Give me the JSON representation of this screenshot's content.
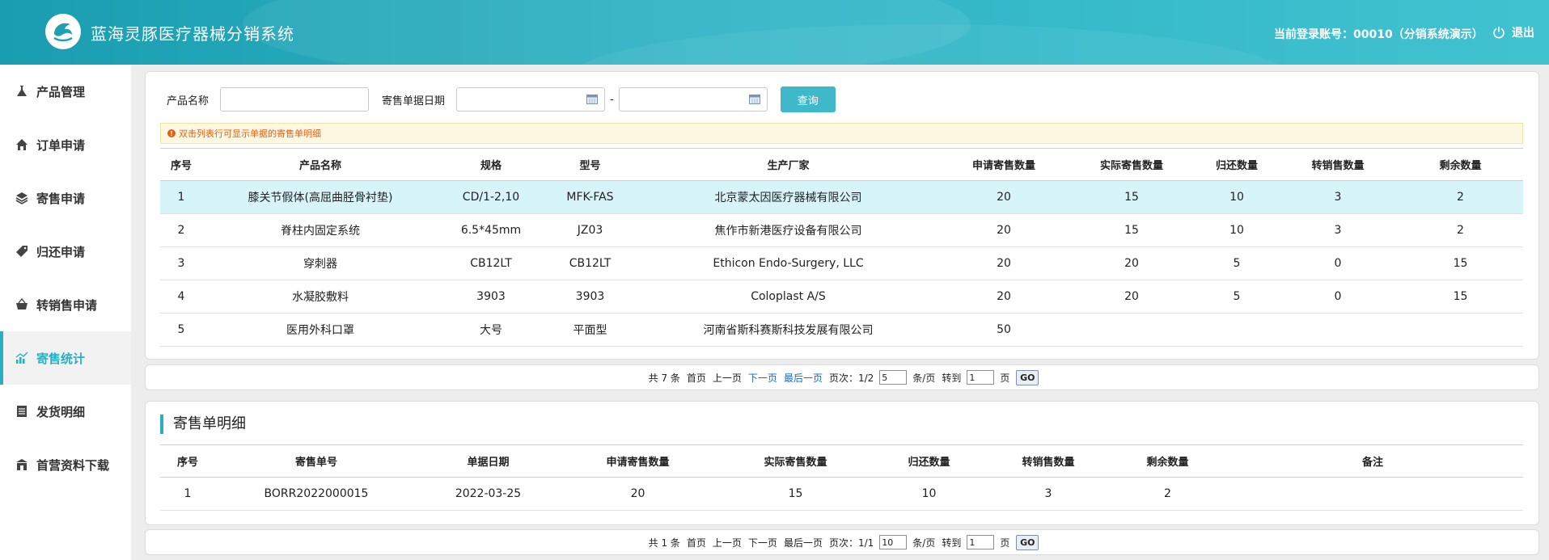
{
  "header": {
    "app_title": "蓝海灵豚医疗器械分销系统",
    "account_text": "当前登录账号：00010（分销系统演示）",
    "logout_label": "退出"
  },
  "sidebar": {
    "items": [
      {
        "label": "产品管理",
        "icon": "flask-icon"
      },
      {
        "label": "订单申请",
        "icon": "home-icon"
      },
      {
        "label": "寄售申请",
        "icon": "layers-icon"
      },
      {
        "label": "归还申请",
        "icon": "tag-icon"
      },
      {
        "label": "转销售申请",
        "icon": "basket-icon"
      },
      {
        "label": "寄售统计",
        "icon": "chart-icon",
        "active": true
      },
      {
        "label": "发货明细",
        "icon": "list-icon"
      },
      {
        "label": "首营资料下载",
        "icon": "building-icon"
      }
    ]
  },
  "search": {
    "product_name_label": "产品名称",
    "product_name_value": "",
    "date_label": "寄售单据日期",
    "date_from": "",
    "date_to": "",
    "date_separator": "-",
    "query_button": "查询"
  },
  "tip": "双击列表行可显示单据的寄售单明细",
  "main_table": {
    "headers": [
      "序号",
      "产品名称",
      "规格",
      "型号",
      "生产厂家",
      "申请寄售数量",
      "实际寄售数量",
      "归还数量",
      "转销售数量",
      "剩余数量"
    ],
    "rows": [
      [
        "1",
        "膝关节假体(高屈曲胫骨衬垫)",
        "CD/1-2,10",
        "MFK-FAS",
        "北京蒙太因医疗器械有限公司",
        "20",
        "15",
        "10",
        "3",
        "2"
      ],
      [
        "2",
        "脊柱内固定系统",
        "6.5*45mm",
        "JZ03",
        "焦作市新港医疗设备有限公司",
        "20",
        "15",
        "10",
        "3",
        "2"
      ],
      [
        "3",
        "穿刺器",
        "CB12LT",
        "CB12LT",
        "Ethicon Endo-Surgery, LLC",
        "20",
        "20",
        "5",
        "0",
        "15"
      ],
      [
        "4",
        "水凝胶敷料",
        "3903",
        "3903",
        "Coloplast A/S",
        "20",
        "20",
        "5",
        "0",
        "15"
      ],
      [
        "5",
        "医用外科口罩",
        "大号",
        "平面型",
        "河南省斯科赛斯科技发展有限公司",
        "50",
        "",
        "",
        "",
        ""
      ]
    ]
  },
  "main_pager": {
    "total": "共 7 条",
    "first": "首页",
    "prev": "上一页",
    "next": "下一页",
    "last": "最后一页",
    "page_label": "页次：1/2",
    "page_size": "5",
    "per_page": "条/页",
    "goto_label": "转到",
    "goto_value": "1",
    "page_unit": "页",
    "go": "GO"
  },
  "detail": {
    "title": "寄售单明细",
    "headers": [
      "序号",
      "寄售单号",
      "单据日期",
      "申请寄售数量",
      "实际寄售数量",
      "归还数量",
      "转销售数量",
      "剩余数量",
      "备注"
    ],
    "rows": [
      [
        "1",
        "BORR2022000015",
        "2022-03-25",
        "20",
        "15",
        "10",
        "3",
        "2",
        ""
      ]
    ]
  },
  "detail_pager": {
    "total": "共 1 条",
    "first": "首页",
    "prev": "上一页",
    "next": "下一页",
    "last": "最后一页",
    "page_label": "页次：1/1",
    "page_size": "10",
    "per_page": "条/页",
    "goto_label": "转到",
    "goto_value": "1",
    "page_unit": "页",
    "go": "GO"
  }
}
